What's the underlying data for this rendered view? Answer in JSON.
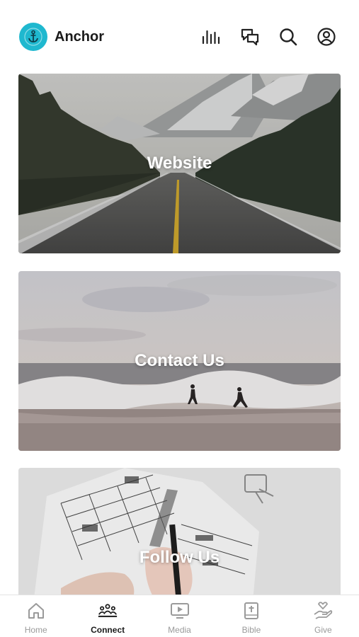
{
  "header": {
    "app_name": "Anchor",
    "logo_icon": "anchor-icon",
    "accent_color": "#1fb8cf",
    "icons": [
      "audio-bars-icon",
      "chat-icon",
      "search-icon",
      "account-icon"
    ]
  },
  "cards": [
    {
      "label": "Website",
      "image": "mountain-road-photo"
    },
    {
      "label": "Contact Us",
      "image": "beach-waves-photo"
    },
    {
      "label": "Follow Us",
      "image": "planner-writing-photo"
    }
  ],
  "bottom_nav": {
    "active": "Connect",
    "items": [
      {
        "label": "Home",
        "icon": "home-icon"
      },
      {
        "label": "Connect",
        "icon": "people-icon"
      },
      {
        "label": "Media",
        "icon": "play-screen-icon"
      },
      {
        "label": "Bible",
        "icon": "bible-icon"
      },
      {
        "label": "Give",
        "icon": "hand-heart-icon"
      }
    ]
  }
}
